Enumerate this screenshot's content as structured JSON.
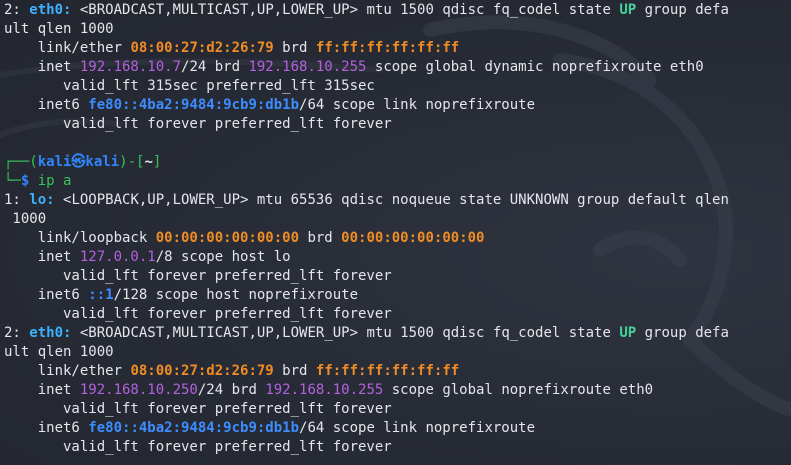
{
  "lines": [
    [
      {
        "t": "2: "
      },
      {
        "t": "eth0:",
        "c": "c-cyan"
      },
      {
        "t": " <BROADCAST,MULTICAST,UP,LOWER_UP> mtu 1500 qdisc fq_codel state "
      },
      {
        "t": "UP",
        "c": "c-up"
      },
      {
        "t": " group defa"
      }
    ],
    [
      {
        "t": "ult qlen 1000"
      }
    ],
    [
      {
        "t": "    link/ether "
      },
      {
        "t": "08:00:27:d2:26:79",
        "c": "c-mac"
      },
      {
        "t": " brd "
      },
      {
        "t": "ff:ff:ff:ff:ff:ff",
        "c": "c-mac"
      }
    ],
    [
      {
        "t": "    inet "
      },
      {
        "t": "192.168.10.7",
        "c": "c-ip"
      },
      {
        "t": "/24 brd "
      },
      {
        "t": "192.168.10.255",
        "c": "c-ip"
      },
      {
        "t": " scope global dynamic noprefixroute eth0"
      }
    ],
    [
      {
        "t": "       valid_lft 315sec preferred_lft 315sec"
      }
    ],
    [
      {
        "t": "    inet6 "
      },
      {
        "t": "fe80::4ba2:9484:9cb9:db1b",
        "c": "c-ip6"
      },
      {
        "t": "/64 scope link noprefixroute"
      }
    ],
    [
      {
        "t": "       valid_lft forever preferred_lft forever"
      }
    ],
    [
      {
        "t": ""
      }
    ],
    [
      {
        "t": "┌──(",
        "c": "c-green"
      },
      {
        "t": "kali㉿kali",
        "c": "c-kali"
      },
      {
        "t": ")-[",
        "c": "c-green"
      },
      {
        "t": "~",
        "c": "c-tilde"
      },
      {
        "t": "]",
        "c": "c-green"
      }
    ],
    [
      {
        "t": "└─",
        "c": "c-green"
      },
      {
        "t": "$",
        "c": "c-dollar"
      },
      {
        "t": " "
      },
      {
        "t": "ip a",
        "c": "c-green"
      }
    ],
    [
      {
        "t": "1: "
      },
      {
        "t": "lo:",
        "c": "c-cyan"
      },
      {
        "t": " <LOOPBACK,UP,LOWER_UP> mtu 65536 qdisc noqueue state UNKNOWN group default qlen"
      }
    ],
    [
      {
        "t": " 1000"
      }
    ],
    [
      {
        "t": "    link/loopback "
      },
      {
        "t": "00:00:00:00:00:00",
        "c": "c-mac"
      },
      {
        "t": " brd "
      },
      {
        "t": "00:00:00:00:00:00",
        "c": "c-mac"
      }
    ],
    [
      {
        "t": "    inet "
      },
      {
        "t": "127.0.0.1",
        "c": "c-ip"
      },
      {
        "t": "/8 scope host lo"
      }
    ],
    [
      {
        "t": "       valid_lft forever preferred_lft forever"
      }
    ],
    [
      {
        "t": "    inet6 "
      },
      {
        "t": "::1",
        "c": "c-ip6"
      },
      {
        "t": "/128 scope host noprefixroute"
      }
    ],
    [
      {
        "t": "       valid_lft forever preferred_lft forever"
      }
    ],
    [
      {
        "t": "2: "
      },
      {
        "t": "eth0:",
        "c": "c-cyan"
      },
      {
        "t": " <BROADCAST,MULTICAST,UP,LOWER_UP> mtu 1500 qdisc fq_codel state "
      },
      {
        "t": "UP",
        "c": "c-up"
      },
      {
        "t": " group defa"
      }
    ],
    [
      {
        "t": "ult qlen 1000"
      }
    ],
    [
      {
        "t": "    link/ether "
      },
      {
        "t": "08:00:27:d2:26:79",
        "c": "c-mac"
      },
      {
        "t": " brd "
      },
      {
        "t": "ff:ff:ff:ff:ff:ff",
        "c": "c-mac"
      }
    ],
    [
      {
        "t": "    inet "
      },
      {
        "t": "192.168.10.250",
        "c": "c-ip"
      },
      {
        "t": "/24 brd "
      },
      {
        "t": "192.168.10.255",
        "c": "c-ip"
      },
      {
        "t": " scope global noprefixroute eth0"
      }
    ],
    [
      {
        "t": "       valid_lft forever preferred_lft forever"
      }
    ],
    [
      {
        "t": "    inet6 "
      },
      {
        "t": "fe80::4ba2:9484:9cb9:db1b",
        "c": "c-ip6"
      },
      {
        "t": "/64 scope link noprefixroute"
      }
    ],
    [
      {
        "t": "       valid_lft forever preferred_lft forever"
      }
    ]
  ],
  "colors": {
    "background": "#272b35",
    "text": "#e4e6ea",
    "interface": "#3db2ff",
    "mac": "#f08c24",
    "ipv4": "#b461e0",
    "ipv6": "#3c8dff",
    "state_up": "#46d39a",
    "prompt_frame": "#37c25b",
    "prompt_user": "#2e86ff"
  }
}
